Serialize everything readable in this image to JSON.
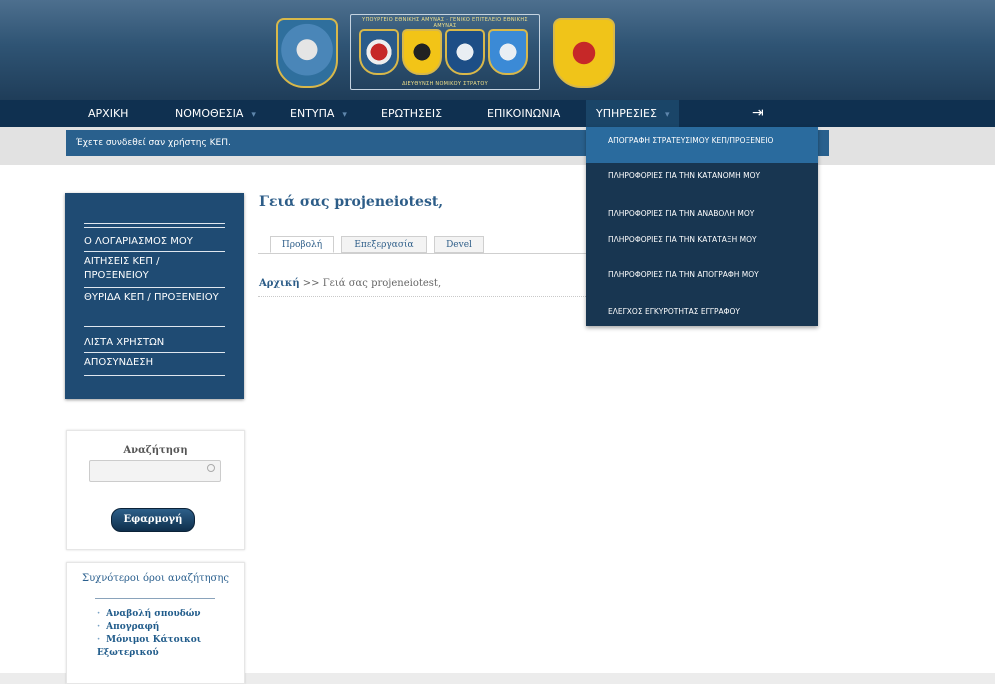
{
  "header": {
    "frame_top_text": "ΥΠΟΥΡΓΕΙΟ ΕΘΝΙΚΗΣ ΑΜΥΝΑΣ · ΓΕΝΙΚΟ ΕΠΙΤΕΛΕΙΟ ΕΘΝΙΚΗΣ ΑΜΥΝΑΣ",
    "frame_bottom_text": "ΔΙΕΥΘΥΝΣΗ ΝΟΜΙΚΟΥ ΣΤΡΑΤΟΥ"
  },
  "nav": {
    "items": [
      {
        "label": "ΑΡΧΙΚΗ"
      },
      {
        "label": "ΝΟΜΟΘΕΣΙΑ"
      },
      {
        "label": "ΕΝΤΥΠΑ"
      },
      {
        "label": "ΕΡΩΤΗΣΕΙΣ"
      },
      {
        "label": "ΕΠΙΚΟΙΝΩΝΙΑ"
      },
      {
        "label": "ΥΠΗΡΕΣΙΕΣ"
      }
    ],
    "caret": "▾",
    "logout_icon": "⇥"
  },
  "status": {
    "login_message": "Έχετε συνδεθεί σαν χρήστης ΚΕΠ."
  },
  "dropdown": {
    "items": [
      {
        "label": "ΑΠΟΓΡΑΦΗ ΣΤΡΑΤΕΥΣΙΜΟΥ ΚΕΠ/ΠΡΟΞΕΝΕΙΟ"
      },
      {
        "label": "ΠΛΗΡΟΦΟΡΙΕΣ ΓΙΑ ΤΗΝ ΚΑΤΑΝΟΜΗ ΜΟΥ"
      },
      {
        "label": "ΠΛΗΡΟΦΟΡΙΕΣ ΓΙΑ ΤΗΝ ΑΝΑΒΟΛΗ ΜΟΥ"
      },
      {
        "label": "ΠΛΗΡΟΦΟΡΙΕΣ ΓΙΑ ΤΗΝ ΚΑΤΑΤΑΞΗ ΜΟΥ"
      },
      {
        "label": "ΠΛΗΡΟΦΟΡΙΕΣ ΓΙΑ ΤΗΝ ΑΠΟΓΡΑΦΗ ΜΟΥ"
      },
      {
        "label": "ΕΛΕΓΧΟΣ ΕΓΚΥΡΟΤΗΤΑΣ ΕΓΓΡΑΦΟΥ"
      }
    ]
  },
  "sidebar": {
    "items": [
      {
        "label": "Ο ΛΟΓΑΡΙΑΣΜΟΣ ΜΟΥ"
      },
      {
        "label": "ΑΙΤΗΣΕΙΣ ΚΕΠ / ΠΡΟΞΕΝΕΙΟΥ"
      },
      {
        "label": "ΘΥΡΙΔΑ ΚΕΠ / ΠΡΟΞΕΝΕΙΟΥ"
      },
      {
        "label": "ΛΙΣΤΑ ΧΡΗΣΤΩΝ"
      },
      {
        "label": "ΑΠΟΣΥΝΔΕΣΗ"
      }
    ]
  },
  "search": {
    "title": "Αναζήτηση",
    "value": "",
    "button": "Εφαρμογή"
  },
  "terms": {
    "title": "Συχνότεροι όροι αναζήτησης",
    "items": [
      "Αναβολή σπουδών",
      "Απογραφή",
      "Μόνιμοι Κάτοικοι Εξωτερικού"
    ]
  },
  "content": {
    "greeting": "Γειά σας projeneiotest,",
    "tabs": [
      "Προβολή",
      "Επεξεργασία",
      "Devel"
    ],
    "breadcrumb_home": "Αρχική",
    "breadcrumb_sep": ">>",
    "breadcrumb_current": "Γειά σας projeneiotest,"
  }
}
